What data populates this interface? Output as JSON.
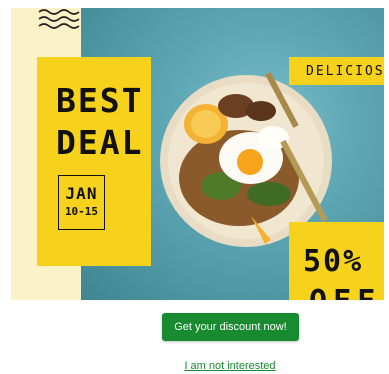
{
  "banner": {
    "headline": "BEST\nDEAL",
    "date_month": "JAN",
    "date_days": "10-15",
    "tag": "DELICIOS",
    "discount_percent": "50%",
    "discount_word": "OFF"
  },
  "actions": {
    "cta_label": "Get your discount now!",
    "dismiss_label": "I am not interested"
  },
  "colors": {
    "accent_yellow": "#f6d21c",
    "cta_green": "#188a2f",
    "background_cream": "#fbf2c7"
  }
}
